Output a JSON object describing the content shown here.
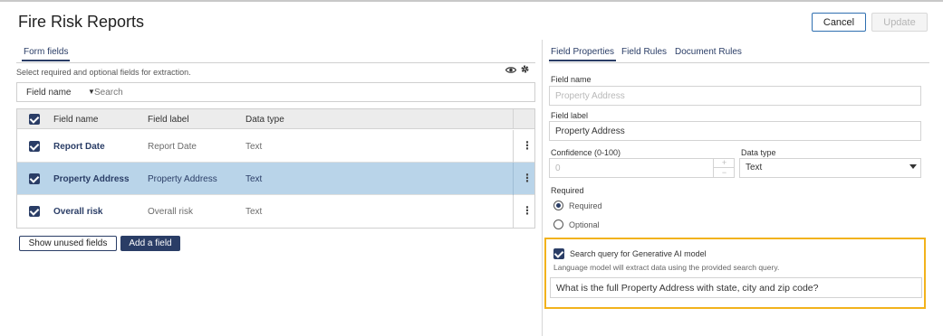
{
  "header": {
    "title": "Fire Risk Reports",
    "cancel_label": "Cancel",
    "update_label": "Update"
  },
  "left": {
    "tab_label": "Form fields",
    "hint": "Select required and optional fields for extraction.",
    "filter": {
      "select_value": "Field name",
      "search_placeholder": "Search"
    },
    "table": {
      "columns": [
        "Field name",
        "Field label",
        "Data type"
      ],
      "rows": [
        {
          "field_name": "Report Date",
          "field_label": "Report Date",
          "data_type": "Text",
          "checked": true,
          "selected": false
        },
        {
          "field_name": "Property Address",
          "field_label": "Property Address",
          "data_type": "Text",
          "checked": true,
          "selected": true
        },
        {
          "field_name": "Overall risk",
          "field_label": "Overall risk",
          "data_type": "Text",
          "checked": true,
          "selected": false
        }
      ]
    },
    "show_unused_label": "Show unused fields",
    "add_field_label": "Add a field"
  },
  "right": {
    "tabs": [
      "Field Properties",
      "Field Rules",
      "Document Rules"
    ],
    "active_tab": "Field Properties",
    "field_name_label": "Field name",
    "field_name_value": "Property Address",
    "field_label_label": "Field label",
    "field_label_value": "Property Address",
    "confidence_label": "Confidence (0-100)",
    "confidence_value": "0",
    "data_type_label": "Data type",
    "data_type_value": "Text",
    "required_label": "Required",
    "options": [
      "Required",
      "Optional"
    ],
    "selected_option": "Required",
    "gen_ai": {
      "checkbox_label": "Search query for Generative AI model",
      "description": "Language model will extract data using the provided search query.",
      "query": "What is the full Property Address with state, city and zip code?",
      "highlight_color": "#f2b21c"
    }
  },
  "colors": {
    "accent": "#2a3d66",
    "selected_row": "#b9d4e9",
    "cancel_border": "#2f6fb0"
  }
}
